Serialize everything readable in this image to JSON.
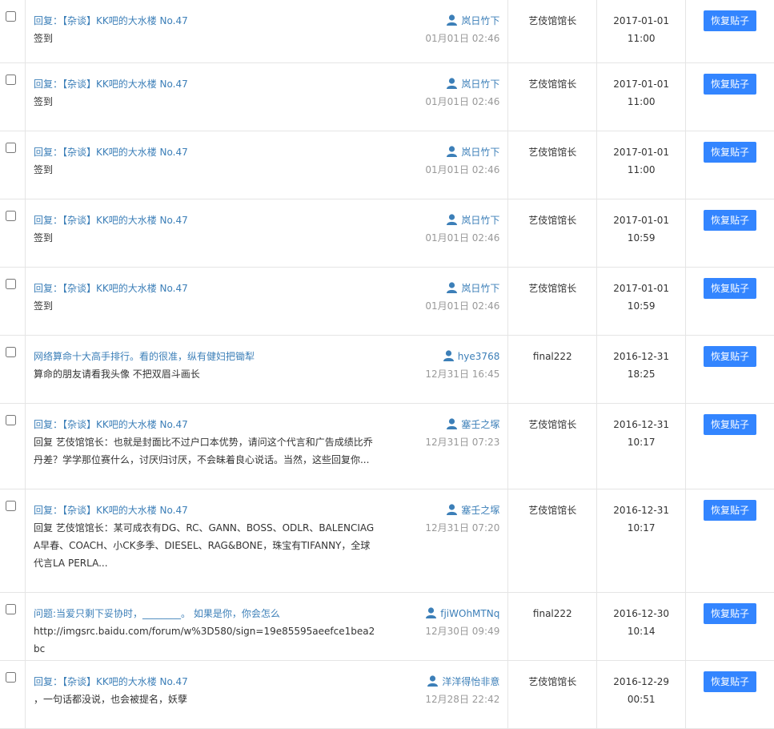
{
  "restore_label": "恢复贴子",
  "rows": [
    {
      "title": "回复：【杂谈】KK吧的大水楼 No.47",
      "body": "签到",
      "author": "岚日竹下",
      "time": "01月01日 02:46",
      "operator": "艺伎馆馆长",
      "date": "2017-01-01",
      "clock": "11:00",
      "h": 79
    },
    {
      "title": "回复：【杂谈】KK吧的大水楼 No.47",
      "body": "签到",
      "author": "岚日竹下",
      "time": "01月01日 02:46",
      "operator": "艺伎馆馆长",
      "date": "2017-01-01",
      "clock": "11:00",
      "h": 85
    },
    {
      "title": "回复：【杂谈】KK吧的大水楼 No.47",
      "body": "签到",
      "author": "岚日竹下",
      "time": "01月01日 02:46",
      "operator": "艺伎馆馆长",
      "date": "2017-01-01",
      "clock": "11:00",
      "h": 85
    },
    {
      "title": "回复：【杂谈】KK吧的大水楼 No.47",
      "body": "签到",
      "author": "岚日竹下",
      "time": "01月01日 02:46",
      "operator": "艺伎馆馆长",
      "date": "2017-01-01",
      "clock": "10:59",
      "h": 85
    },
    {
      "title": "回复：【杂谈】KK吧的大水楼 No.47",
      "body": "签到",
      "author": "岚日竹下",
      "time": "01月01日 02:46",
      "operator": "艺伎馆馆长",
      "date": "2017-01-01",
      "clock": "10:59",
      "h": 85
    },
    {
      "title": "网络算命十大高手排行。看的很准，纵有健妇把锄犁",
      "body": "算命的朋友请看我头像 不把双眉斗画长",
      "author": "hye3768",
      "time": "12月31日 16:45",
      "operator": "final222",
      "date": "2016-12-31",
      "clock": "18:25",
      "h": 85
    },
    {
      "title": "回复：【杂谈】KK吧的大水楼 No.47",
      "body": "回复 艺伎馆馆长：也就是封面比不过户口本优势，请问这个代言和广告成绩比乔丹差？学学那位赛什么，讨厌归讨厌，不会昧着良心说话。当然，这些回复你...",
      "author": "塞壬之塚",
      "time": "12月31日 07:23",
      "operator": "艺伎馆馆长",
      "date": "2016-12-31",
      "clock": "10:17",
      "h": 107
    },
    {
      "title": "回复：【杂谈】KK吧的大水楼 No.47",
      "body": "回复 艺伎馆馆长：某可成衣有DG、RC、GANN、BOSS、ODLR、BALENCIAGA早春、COACH、小CK多季、DIESEL、RAG&BONE，珠宝有TIFANNY，全球代言LA PERLA...",
      "author": "塞壬之塚",
      "time": "12月31日 07:20",
      "operator": "艺伎馆馆长",
      "date": "2016-12-31",
      "clock": "10:17",
      "h": 129
    },
    {
      "title": "问题:当爱只剩下妥协时，________。 如果是你，你会怎么",
      "body": "http://imgsrc.baidu.com/forum/w%3D580/sign=19e85595aeefce1bea2bc",
      "author": "fjiWOhMTNq",
      "time": "12月30日 09:49",
      "operator": "final222",
      "date": "2016-12-30",
      "clock": "10:14",
      "h": 85
    },
    {
      "title": "回复：【杂谈】KK吧的大水楼 No.47",
      "body": "，一句话都没说，也会被提名，妖孽",
      "author": "洋洋得怡非意",
      "time": "12月28日 22:42",
      "operator": "艺伎馆馆长",
      "date": "2016-12-29",
      "clock": "00:51",
      "h": 85
    }
  ]
}
